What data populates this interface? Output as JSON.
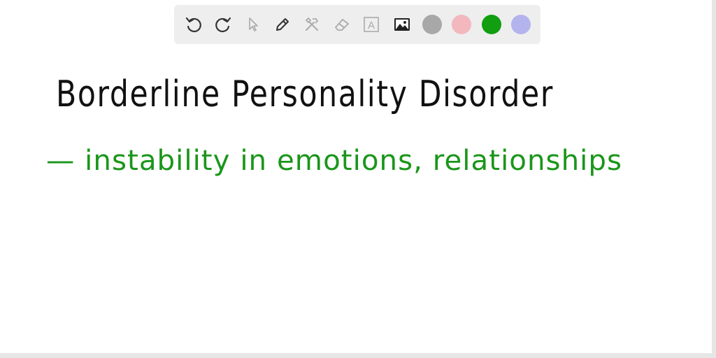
{
  "toolbar": {
    "tools": [
      {
        "name": "undo-icon"
      },
      {
        "name": "redo-icon"
      },
      {
        "name": "pointer-icon"
      },
      {
        "name": "pencil-icon"
      },
      {
        "name": "tools-icon"
      },
      {
        "name": "eraser-icon"
      },
      {
        "name": "text-icon",
        "glyph": "A"
      },
      {
        "name": "image-icon"
      }
    ],
    "swatches": [
      {
        "name": "gray",
        "color": "#a8a8a8"
      },
      {
        "name": "pink",
        "color": "#f2b8bd"
      },
      {
        "name": "green",
        "color": "#119e11"
      },
      {
        "name": "lavender",
        "color": "#b3b3ee"
      }
    ]
  },
  "board": {
    "title": "Borderline Personality Disorder",
    "bullet": "— instability in emotions, relationships",
    "title_color": "#111111",
    "bullet_color": "#1a961a"
  }
}
